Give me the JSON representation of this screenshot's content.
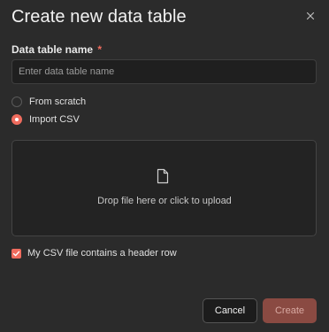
{
  "dialog": {
    "title": "Create new data table",
    "close_icon": "close-icon"
  },
  "name_field": {
    "label": "Data table name",
    "required_mark": "*",
    "placeholder": "Enter data table name",
    "value": ""
  },
  "source_options": [
    {
      "label": "From scratch",
      "selected": false
    },
    {
      "label": "Import CSV",
      "selected": true
    }
  ],
  "dropzone": {
    "icon": "file-icon",
    "text": "Drop file here or click to upload"
  },
  "header_row_checkbox": {
    "label": "My CSV file contains a header row",
    "checked": true
  },
  "buttons": {
    "cancel": "Cancel",
    "create": "Create"
  },
  "colors": {
    "accent": "#ef6c5e",
    "background": "#2b2b2b",
    "create_disabled": "#8a4a42"
  }
}
